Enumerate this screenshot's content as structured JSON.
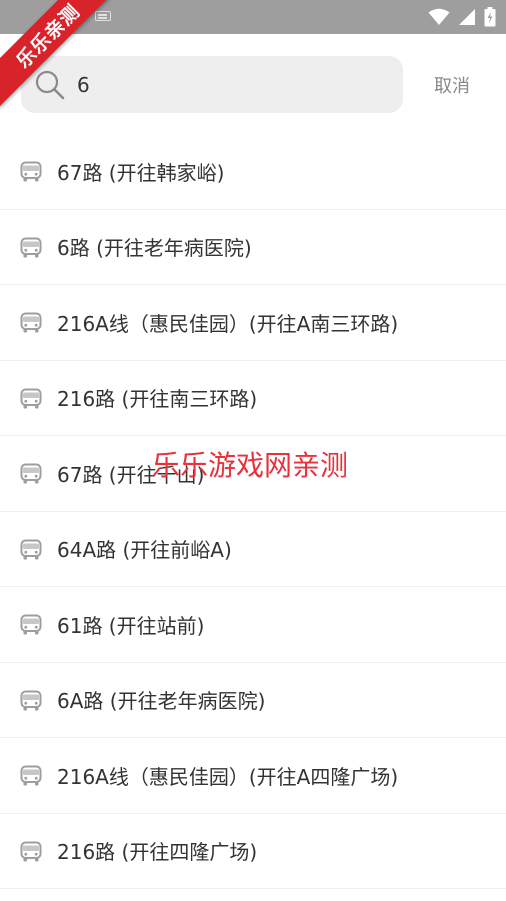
{
  "ribbon": {
    "text": "乐乐亲测"
  },
  "search": {
    "value": "6",
    "placeholder": ""
  },
  "cancel_label": "取消",
  "results": [
    {
      "label": "67路 (开往韩家峪)"
    },
    {
      "label": "6路 (开往老年病医院)"
    },
    {
      "label": "216A线（惠民佳园）(开往A南三环路)"
    },
    {
      "label": "216路 (开往南三环路)"
    },
    {
      "label": "67路 (开往千山)"
    },
    {
      "label": "64A路 (开往前峪A)"
    },
    {
      "label": "61路 (开往站前)"
    },
    {
      "label": "6A路 (开往老年病医院)"
    },
    {
      "label": "216A线（惠民佳园）(开往A四隆广场)"
    },
    {
      "label": "216路 (开往四隆广场)"
    }
  ],
  "watermark": "乐乐游戏网亲测",
  "icons": {
    "search": "search-icon",
    "bus": "bus-icon",
    "wifi": "wifi-icon",
    "signal": "signal-icon",
    "battery": "battery-icon",
    "keyboard": "keyboard-icon"
  },
  "colors": {
    "status_bar": "#9e9e9e",
    "ribbon": "#d8232a",
    "watermark": "#e8313a",
    "search_bg": "#eeeeee",
    "text": "#333333",
    "muted": "#888888"
  }
}
